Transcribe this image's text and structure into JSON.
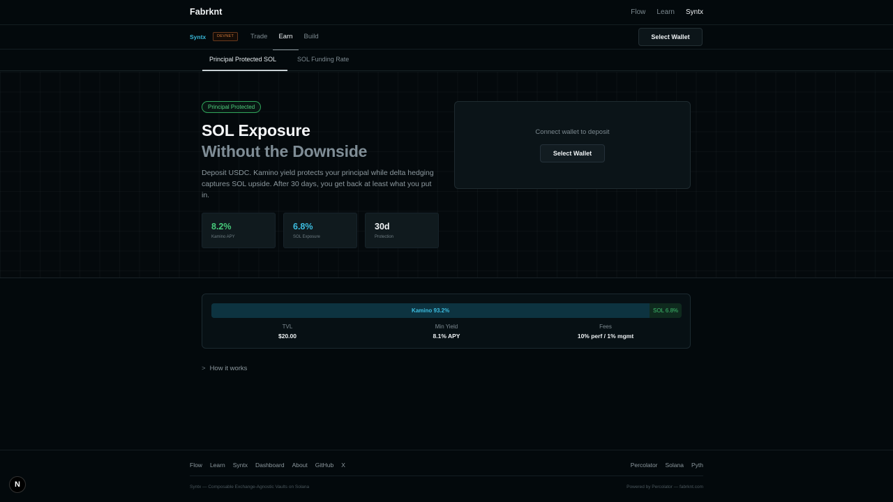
{
  "header": {
    "brand": "Fabrknt",
    "nav": [
      {
        "label": "Flow",
        "active": false
      },
      {
        "label": "Learn",
        "active": false
      },
      {
        "label": "Syntx",
        "active": true
      }
    ]
  },
  "subheader": {
    "brand": "Syntx",
    "env_badge": "DEVNET",
    "nav": [
      {
        "label": "Trade",
        "active": false
      },
      {
        "label": "Earn",
        "active": true
      },
      {
        "label": "Build",
        "active": false
      }
    ],
    "wallet_button": "Select Wallet"
  },
  "tabs": [
    {
      "label": "Principal Protected SOL",
      "active": true
    },
    {
      "label": "SOL Funding Rate",
      "active": false
    }
  ],
  "hero": {
    "badge": "Principal Protected",
    "title_line1": "SOL Exposure",
    "title_line2": "Without the Downside",
    "description": "Deposit USDC. Kamino yield protects your principal while delta hedging captures SOL upside. After 30 days, you get back at least what you put in.",
    "stats": [
      {
        "value": "8.2%",
        "label": "Kamino APY",
        "color": "#46c97a"
      },
      {
        "value": "6.8%",
        "label": "SOL Exposure",
        "color": "#3cbde0"
      },
      {
        "value": "30d",
        "label": "Protection",
        "color": "#f2f5f7"
      }
    ]
  },
  "deposit": {
    "prompt": "Connect wallet to deposit",
    "wallet_button": "Select Wallet"
  },
  "allocation": {
    "kamino_label": "Kamino 93.2%",
    "kamino_pct": 93.2,
    "sol_label": "SOL 6.8%",
    "sol_pct": 6.8,
    "metrics": [
      {
        "label": "TVL",
        "value": "$20.00"
      },
      {
        "label": "Min Yield",
        "value": "8.1% APY"
      },
      {
        "label": "Fees",
        "value": "10% perf / 1% mgmt"
      }
    ]
  },
  "how_it_works": {
    "chevron": ">",
    "label": "How it works"
  },
  "footer": {
    "links_left": [
      "Flow",
      "Learn",
      "Syntx",
      "Dashboard",
      "About",
      "GitHub",
      "X"
    ],
    "links_right": [
      "Percolator",
      "Solana",
      "Pyth"
    ],
    "tagline_left": "Syntx — Composable Exchange-Agnostic Vaults on Solana",
    "tagline_right": "Powered by Percolator — fabrknt.com"
  },
  "dev_badge": "N",
  "colors": {
    "accent_cyan": "#3cbde0",
    "accent_green": "#46c97a",
    "background": "#03090c"
  }
}
